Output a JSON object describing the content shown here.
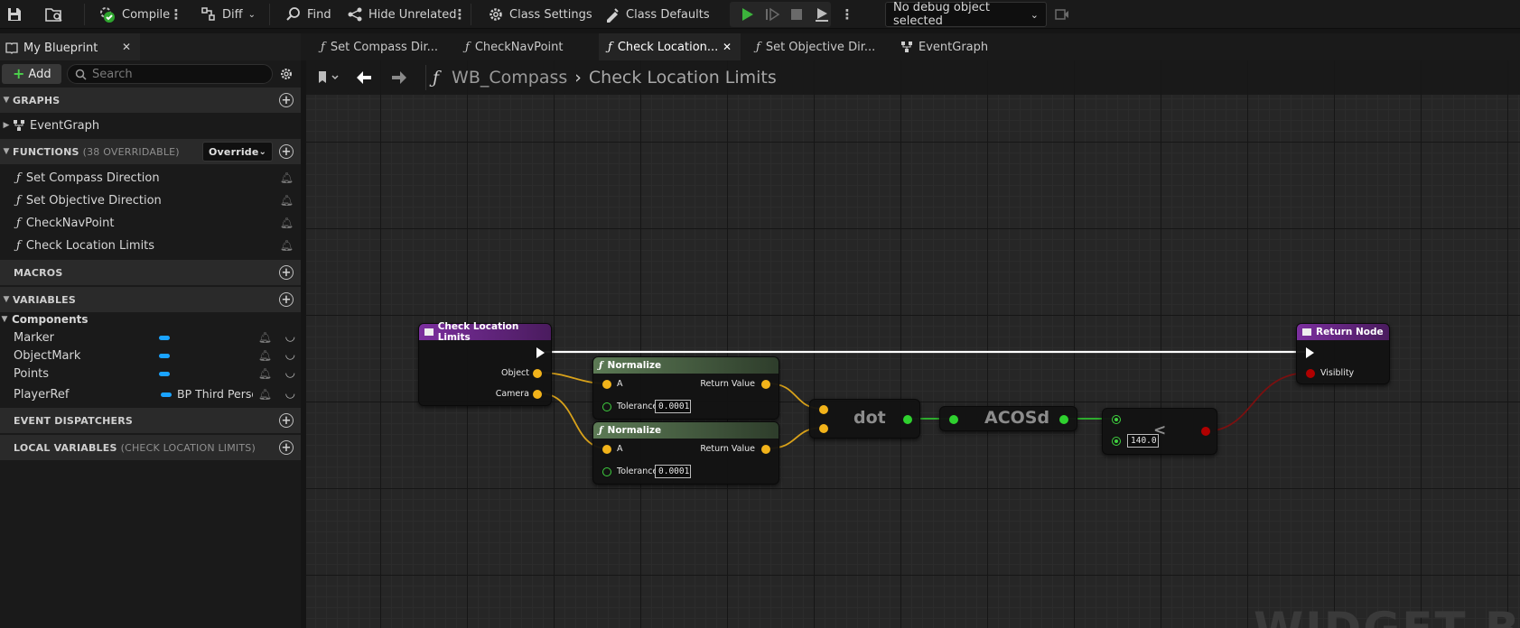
{
  "toolbar": {
    "compile": "Compile",
    "diff": "Diff",
    "find": "Find",
    "hide_unrelated": "Hide Unrelated",
    "class_settings": "Class Settings",
    "class_defaults": "Class Defaults",
    "debug_object": "No debug object selected"
  },
  "left_panel": {
    "tab_title": "My Blueprint",
    "add": "Add",
    "search_placeholder": "Search",
    "graphs": {
      "header": "GRAPHS",
      "items": [
        "EventGraph"
      ]
    },
    "functions": {
      "header": "FUNCTIONS",
      "sub": "(38 OVERRIDABLE)",
      "override": "Override",
      "items": [
        "Set Compass Direction",
        "Set Objective Direction",
        "CheckNavPoint",
        "Check Location Limits"
      ]
    },
    "macros": {
      "header": "MACROS"
    },
    "variables": {
      "header": "VARIABLES",
      "category": "Components",
      "items": [
        {
          "name": "Marker",
          "type": ""
        },
        {
          "name": "ObjectMark",
          "type": ""
        },
        {
          "name": "Points",
          "type": ""
        },
        {
          "name": "PlayerRef",
          "type": "BP Third Perso"
        }
      ]
    },
    "event_dispatchers": {
      "header": "EVENT DISPATCHERS"
    },
    "local_variables": {
      "header": "LOCAL VARIABLES",
      "sub": "(CHECK LOCATION LIMITS)"
    }
  },
  "doc_tabs": [
    "Set Compass Dir...",
    "CheckNavPoint",
    "Check Location...",
    "Set Objective Dir...",
    "EventGraph"
  ],
  "breadcrumb": {
    "root": "WB_Compass",
    "current": "Check Location Limits"
  },
  "graph": {
    "entry_node": {
      "title": "Check Location Limits",
      "pins": [
        "Object",
        "Camera"
      ]
    },
    "normalize_1": {
      "title": "Normalize",
      "input": "A",
      "output": "Return Value",
      "tolerance_label": "Tolerance",
      "tolerance": "0.0001"
    },
    "normalize_2": {
      "title": "Normalize",
      "input": "A",
      "output": "Return Value",
      "tolerance_label": "Tolerance",
      "tolerance": "0.0001"
    },
    "dot_node": {
      "label": "dot"
    },
    "acos_node": {
      "label": "ACOSd"
    },
    "compare_node": {
      "label": "<",
      "value": "140.0"
    },
    "return_node": {
      "title": "Return Node",
      "pin": "Visiblity"
    },
    "watermark": "WIDGET BLU"
  },
  "colors": {
    "function_entry": "#7b2f9e",
    "pure_function": "#5c7a55",
    "vector_pin": "#f2b31a",
    "float_pin": "#2fd12f",
    "bool_pin": "#b00000",
    "object_pin": "#1aa3ff"
  }
}
